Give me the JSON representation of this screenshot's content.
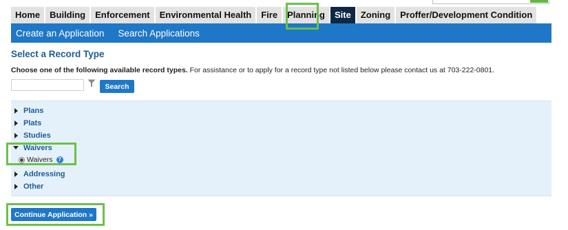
{
  "tabs": [
    {
      "label": "Home",
      "active": false
    },
    {
      "label": "Building",
      "active": false
    },
    {
      "label": "Enforcement",
      "active": false
    },
    {
      "label": "Environmental Health",
      "active": false
    },
    {
      "label": "Fire",
      "active": false
    },
    {
      "label": "Planning",
      "active": false
    },
    {
      "label": "Site",
      "active": true
    },
    {
      "label": "Zoning",
      "active": false
    },
    {
      "label": "Proffer/Development Condition",
      "active": false
    }
  ],
  "subnav": {
    "create": "Create an Application",
    "search": "Search Applications"
  },
  "page_title": "Select a Record Type",
  "instructions": {
    "bold": "Choose one of the following available record types.",
    "rest": " For assistance or to apply for a record type not listed below please contact us at 703-222-0801."
  },
  "search": {
    "placeholder": "",
    "value": "",
    "button": "Search",
    "filter_icon": "filter-icon"
  },
  "record_types": [
    {
      "label": "Plans",
      "expanded": false
    },
    {
      "label": "Plats",
      "expanded": false
    },
    {
      "label": "Studies",
      "expanded": false
    },
    {
      "label": "Waivers",
      "expanded": true
    },
    {
      "label": "Addressing",
      "expanded": false
    },
    {
      "label": "Other",
      "expanded": false
    }
  ],
  "waivers_option": {
    "label": "Waivers",
    "selected": true,
    "help_icon": "question-icon"
  },
  "continue_button": "Continue Application »",
  "colors": {
    "nav_blue": "#1f77c7",
    "active_tab": "#0b2845",
    "panel_bg": "#e5f1fa",
    "highlight": "#6cc04a",
    "link": "#1d5c92"
  }
}
